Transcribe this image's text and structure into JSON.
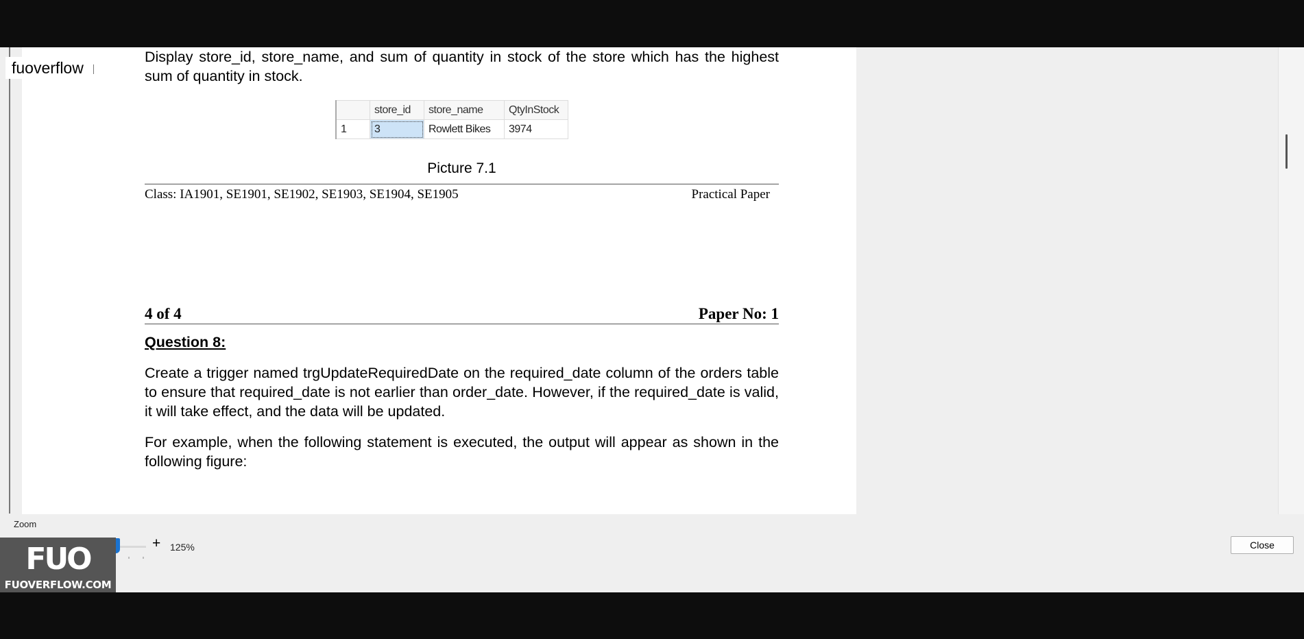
{
  "watermark": {
    "text": "fuoverflow"
  },
  "document": {
    "q7_text": "Display store_id, store_name, and sum of quantity in stock of the store which has the highest sum of quantity in stock.",
    "result_table": {
      "columns": [
        "store_id",
        "store_name",
        "QtyInStock"
      ],
      "rows": [
        {
          "row_number": "1",
          "cells": [
            "3",
            "Rowlett Bikes",
            "3974"
          ]
        }
      ]
    },
    "caption": "Picture 7.1",
    "footer_left": "Class: IA1901, SE1901, SE1902, SE1903, SE1904, SE1905",
    "footer_right": "Practical Paper",
    "header_left": "4 of 4",
    "header_right": "Paper No: 1",
    "question_title": "Question 8:",
    "q8_paragraph1": "Create a trigger named trgUpdateRequiredDate on the required_date column of the orders table to ensure that required_date is not earlier than order_date. However, if the required_date is valid, it will take effect, and the data will be updated.",
    "q8_paragraph2": "For example, when the following statement is executed, the output will appear as shown in the following figure:"
  },
  "zoom": {
    "label": "Zoom",
    "minus": "-",
    "plus": "+",
    "value": "125%",
    "level_percent": 125
  },
  "close_button": {
    "label": "Close"
  },
  "brand": {
    "logo": "FUO",
    "text": "FUOVERFLOW.COM"
  }
}
